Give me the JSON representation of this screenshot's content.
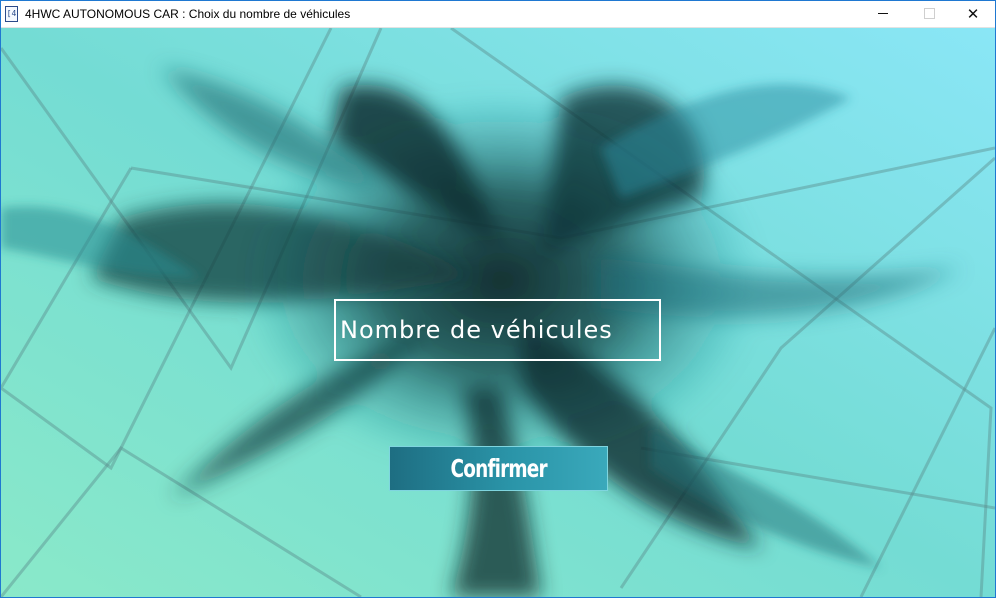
{
  "window": {
    "app_icon_glyph": "[4",
    "title": "4HWC AUTONOMOUS CAR : Choix du nombre de véhicules",
    "controls": {
      "minimize_icon": "minimize-icon",
      "maximize_icon": "maximize-icon",
      "close_glyph": "✕"
    }
  },
  "form": {
    "field_text": "Nombre de véhicules",
    "confirm_label": "Confirmer"
  },
  "colors": {
    "background_start": "#8ae9c9",
    "background_end": "#7ee3f6",
    "smoke_dark": "#0f2f30",
    "button": "#2a94a8",
    "field_border": "#ffffff"
  }
}
